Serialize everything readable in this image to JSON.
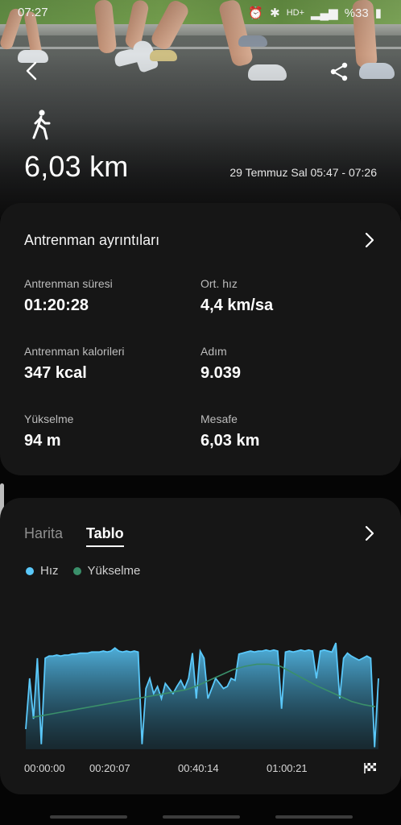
{
  "status": {
    "time": "07:27",
    "battery": "%33",
    "network": "HD+"
  },
  "hero": {
    "distance": "6,03 km",
    "date_range": "29 Temmuz Sal 05:47 - 07:26",
    "activity_icon": "walking-icon"
  },
  "details": {
    "title": "Antrenman ayrıntıları",
    "stats": [
      {
        "label": "Antrenman süresi",
        "value": "01:20:28"
      },
      {
        "label": "Ort. hız",
        "value": "4,4 km/sa"
      },
      {
        "label": "Antrenman kalorileri",
        "value": "347 kcal"
      },
      {
        "label": "Adım",
        "value": "9.039"
      },
      {
        "label": "Yükselme",
        "value": "94 m"
      },
      {
        "label": "Mesafe",
        "value": "6,03 km"
      }
    ]
  },
  "chart_card": {
    "tabs": [
      {
        "label": "Harita",
        "active": false
      },
      {
        "label": "Tablo",
        "active": true
      }
    ],
    "legend": [
      {
        "label": "Hız",
        "color": "#5ac8fa"
      },
      {
        "label": "Yükselme",
        "color": "#3a8f6a"
      }
    ]
  },
  "chart_data": {
    "type": "area",
    "x_tick_labels": [
      "00:00:00",
      "00:20:07",
      "00:40:14",
      "01:00:21"
    ],
    "series": [
      {
        "name": "Hız",
        "color": "#5ac8fa",
        "values": [
          0.2,
          0.7,
          0.3,
          0.9,
          0.05,
          0.9,
          0.92,
          0.92,
          0.93,
          0.92,
          0.93,
          0.93,
          0.94,
          0.94,
          0.95,
          0.95,
          0.95,
          0.96,
          0.96,
          0.96,
          0.97,
          0.96,
          0.97,
          1.0,
          0.97,
          0.96,
          0.97,
          0.96,
          0.97,
          0.96,
          0.05,
          0.6,
          0.7,
          0.55,
          0.62,
          0.5,
          0.65,
          0.6,
          0.55,
          0.62,
          0.68,
          0.6,
          0.7,
          0.95,
          0.5,
          0.97,
          0.9,
          0.5,
          0.6,
          0.7,
          0.65,
          0.6,
          0.62,
          0.7,
          0.68,
          0.94,
          0.95,
          0.96,
          0.97,
          0.96,
          0.97,
          0.97,
          0.98,
          0.97,
          0.98,
          0.97,
          0.4,
          0.96,
          0.97,
          0.96,
          0.97,
          0.98,
          0.97,
          0.98,
          0.97,
          0.7,
          0.97,
          0.98,
          0.97,
          0.96,
          1.05,
          0.5,
          0.9,
          0.95,
          0.92,
          0.9,
          0.88,
          0.9,
          0.92,
          0.9,
          0.02,
          0.7
        ]
      },
      {
        "name": "Yükselme",
        "color": "#3a8f6a",
        "values": [
          0.3,
          0.32,
          0.34,
          0.36,
          0.38,
          0.4,
          0.42,
          0.44,
          0.46,
          0.48,
          0.5,
          0.52,
          0.54,
          0.56,
          0.6,
          0.65,
          0.7,
          0.75,
          0.78,
          0.8,
          0.8,
          0.78,
          0.72,
          0.66,
          0.6,
          0.55,
          0.5,
          0.45,
          0.42,
          0.4
        ]
      }
    ]
  }
}
